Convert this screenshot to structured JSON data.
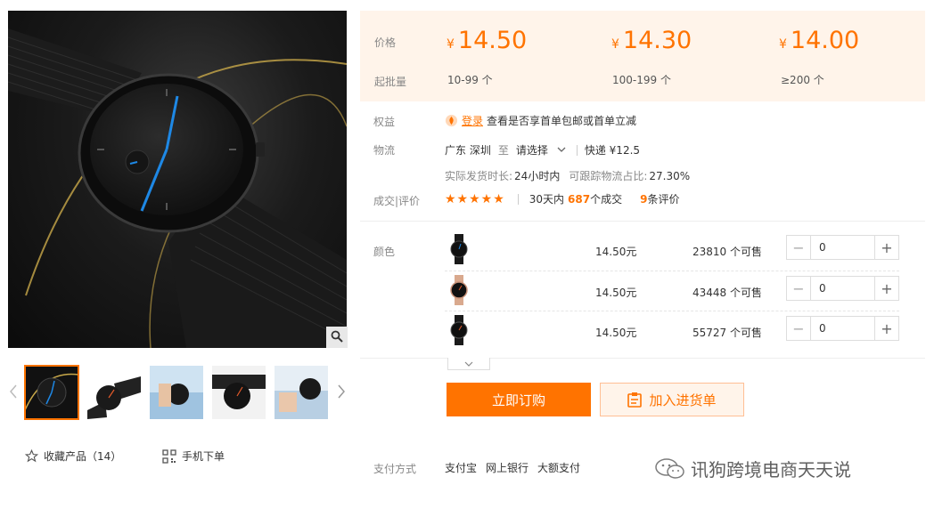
{
  "gallery": {
    "thumbnails": [
      {
        "name": "thumb-1",
        "active": true
      },
      {
        "name": "thumb-2",
        "active": false
      },
      {
        "name": "thumb-3",
        "active": false
      },
      {
        "name": "thumb-4",
        "active": false
      },
      {
        "name": "thumb-5",
        "active": false
      }
    ],
    "icons": {
      "zoom": "magnifier-icon",
      "prev": "chevron-left-icon",
      "next": "chevron-right-icon"
    }
  },
  "utilities": {
    "favorite_label": "收藏产品（14）",
    "mobile_order_label": "手机下单"
  },
  "price_block": {
    "price_label": "价格",
    "moq_label": "起批量",
    "currency_symbol": "¥",
    "tiers": [
      {
        "price": "14.50",
        "range": "10-99 个"
      },
      {
        "price": "14.30",
        "range": "100-199 个"
      },
      {
        "price": "14.00",
        "range": "≥200 个"
      }
    ]
  },
  "benefits": {
    "label": "权益",
    "login_link": "登录",
    "text": "查看是否享首单包邮或首单立减"
  },
  "logistics": {
    "label": "物流",
    "origin": "广东 深圳",
    "to": "至",
    "destination_select": "请选择",
    "shipping": "快递 ¥12.5",
    "ship_time_label": "实际发货时长:",
    "ship_time_value": "24小时内",
    "trackable_label": "可跟踪物流占比:",
    "trackable_value": "27.30%"
  },
  "reviews": {
    "label": "成交|评价",
    "stars": "★★★★★",
    "deals_prefix": "30天内",
    "deals_count": "687",
    "deals_suffix": "个成交",
    "review_count": "9",
    "review_suffix": "条评价"
  },
  "sku": {
    "label": "颜色",
    "items": [
      {
        "price": "14.50元",
        "stock": "23810 个可售",
        "quantity": "0",
        "strap": "black"
      },
      {
        "price": "14.50元",
        "stock": "43448 个可售",
        "quantity": "0",
        "strap": "rose-gold"
      },
      {
        "price": "14.50元",
        "stock": "55727 个可售",
        "quantity": "0",
        "strap": "black"
      }
    ]
  },
  "actions": {
    "buy_now": "立即订购",
    "add_to_list": "加入进货单"
  },
  "payment": {
    "label": "支付方式",
    "methods": [
      "支付宝",
      "网上银行",
      "大额支付"
    ]
  },
  "watermark": "讯狗跨境电商天天说",
  "colors": {
    "accent": "#ff7300",
    "price_bg": "#fff4ea"
  }
}
